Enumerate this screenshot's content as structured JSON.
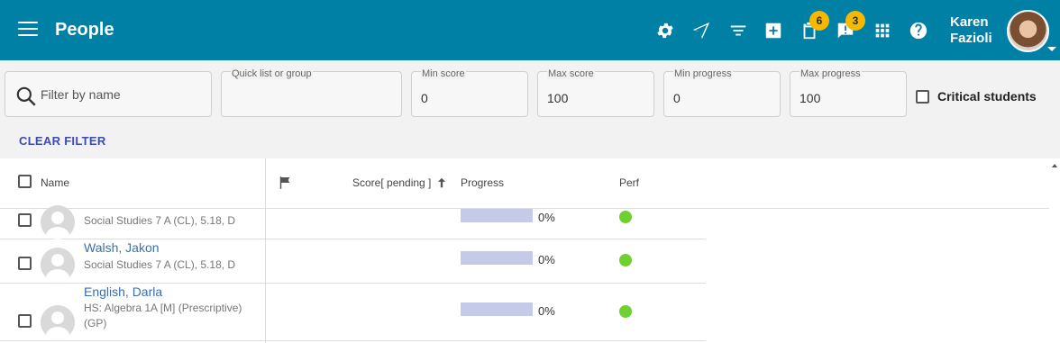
{
  "header": {
    "title": "People",
    "user_first": "Karen",
    "user_last": "Fazioli",
    "badges": {
      "clipboard": "6",
      "alerts": "3"
    }
  },
  "filters": {
    "search_placeholder": "Filter by name",
    "quick_list_label": "Quick list or group",
    "quick_list_value": "",
    "min_score_label": "Min score",
    "min_score_value": "0",
    "max_score_label": "Max score",
    "max_score_value": "100",
    "min_progress_label": "Min progress",
    "min_progress_value": "0",
    "max_progress_label": "Max progress",
    "max_progress_value": "100",
    "critical_label": "Critical students",
    "clear_label": "CLEAR FILTER"
  },
  "table": {
    "columns": {
      "name": "Name",
      "score": "Score[ pending ]",
      "progress": "Progress",
      "perf": "Perf"
    },
    "rows": [
      {
        "name": "",
        "course": "Social Studies 7 A (CL), 5.18, D",
        "progress_pct": 0,
        "progress_text": "0%",
        "perf": "green"
      },
      {
        "name": "Walsh, Jakon",
        "course": "Social Studies 7 A (CL), 5.18, D",
        "progress_pct": 0,
        "progress_text": "0%",
        "perf": "green"
      },
      {
        "name": "English, Darla",
        "course": "HS: Algebra 1A [M] (Prescriptive) (GP)",
        "progress_pct": 0,
        "progress_text": "0%",
        "perf": "green"
      }
    ]
  },
  "colors": {
    "topbar": "#0080a5",
    "accent": "#3d4bb0",
    "badge": "#f6b800",
    "perf_green": "#6ed12f",
    "progress_bar": "#c5cae9"
  }
}
